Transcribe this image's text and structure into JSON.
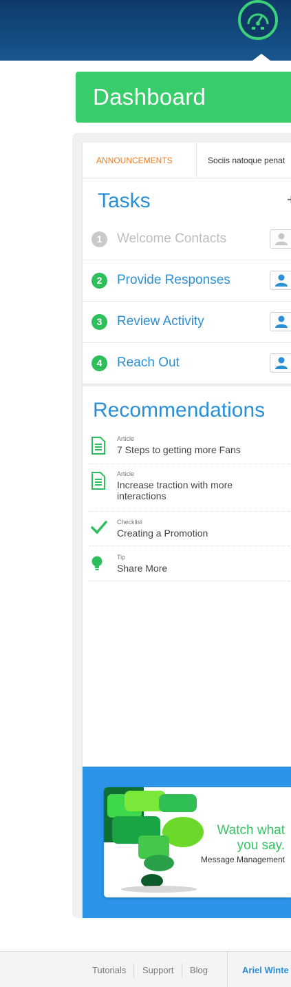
{
  "header": {
    "gauge_icon": "speedometer-icon"
  },
  "dashboard": {
    "title": "Dashboard"
  },
  "tabs": {
    "announcements_label": "ANNOUNCEMENTS",
    "announcement_text": "Sociis natoque penat"
  },
  "tasks": {
    "title": "Tasks",
    "add_label": "+",
    "items": [
      {
        "number": "1",
        "label": "Welcome Contacts",
        "state": "done"
      },
      {
        "number": "2",
        "label": "Provide Responses",
        "state": "open"
      },
      {
        "number": "3",
        "label": "Review Activity",
        "state": "open"
      },
      {
        "number": "4",
        "label": "Reach Out",
        "state": "open"
      }
    ]
  },
  "recommendations": {
    "title": "Recommendations",
    "items": [
      {
        "type": "Article",
        "text": "7 Steps to getting more Fans",
        "icon": "document-icon"
      },
      {
        "type": "Article",
        "text": "Increase traction with more interactions",
        "icon": "document-icon"
      },
      {
        "type": "Checklist",
        "text": "Creating a Promotion",
        "icon": "checkmark-icon"
      },
      {
        "type": "Tip",
        "text": "Share More",
        "icon": "lightbulb-icon"
      }
    ]
  },
  "promo": {
    "line1": "Watch what",
    "line2": "you say.",
    "subtitle": "Message Management"
  },
  "footer": {
    "links": [
      "Tutorials",
      "Support",
      "Blog"
    ],
    "user_name": "Ariel Winte"
  },
  "colors": {
    "header_navy": "#134a80",
    "accent_green": "#38cc6a",
    "accent_blue": "#2b8fd6",
    "announce_orange": "#f07c1e",
    "promo_blue": "#2b94e8"
  }
}
